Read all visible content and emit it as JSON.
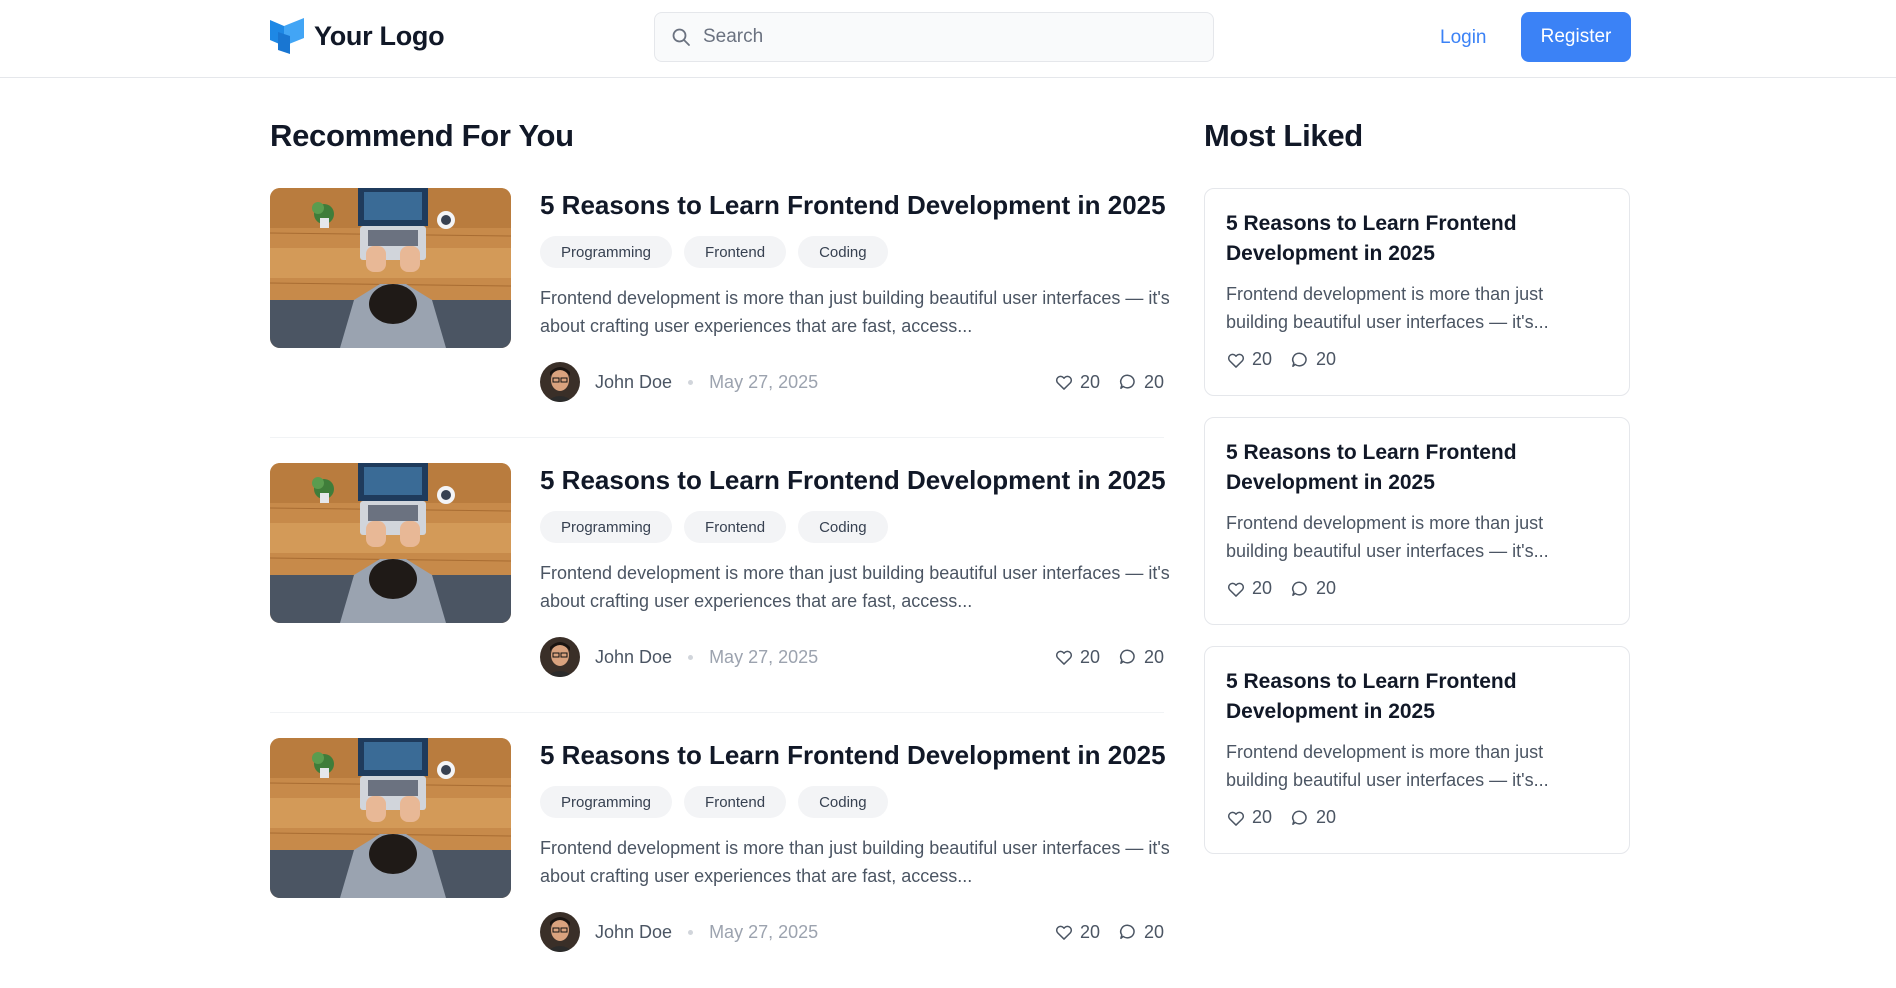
{
  "header": {
    "logo_text": "Your Logo",
    "search_placeholder": "Search",
    "login_label": "Login",
    "register_label": "Register",
    "brand_color": "#3b82f6"
  },
  "recommend": {
    "title": "Recommend For You",
    "articles": [
      {
        "title": "5 Reasons to Learn Frontend Development in 2025",
        "tags": [
          "Programming",
          "Frontend",
          "Coding"
        ],
        "excerpt": "Frontend development is more than just building beautiful user interfaces — it's about crafting user experiences that are fast, access...",
        "author": "John Doe",
        "date": "May 27, 2025",
        "likes": "20",
        "comments": "20"
      },
      {
        "title": "5 Reasons to Learn Frontend Development in 2025",
        "tags": [
          "Programming",
          "Frontend",
          "Coding"
        ],
        "excerpt": "Frontend development is more than just building beautiful user interfaces — it's about crafting user experiences that are fast, access...",
        "author": "John Doe",
        "date": "May 27, 2025",
        "likes": "20",
        "comments": "20"
      },
      {
        "title": "5 Reasons to Learn Frontend Development in 2025",
        "tags": [
          "Programming",
          "Frontend",
          "Coding"
        ],
        "excerpt": "Frontend development is more than just building beautiful user interfaces — it's about crafting user experiences that are fast, access...",
        "author": "John Doe",
        "date": "May 27, 2025",
        "likes": "20",
        "comments": "20"
      }
    ]
  },
  "most_liked": {
    "title": "Most Liked",
    "cards": [
      {
        "title": "5 Reasons to Learn Frontend Development in 2025",
        "excerpt": "Frontend development is more than just building beautiful user interfaces — it's...",
        "likes": "20",
        "comments": "20"
      },
      {
        "title": "5 Reasons to Learn Frontend Development in 2025",
        "excerpt": "Frontend development is more than just building beautiful user interfaces — it's...",
        "likes": "20",
        "comments": "20"
      },
      {
        "title": "5 Reasons to Learn Frontend Development in 2025",
        "excerpt": "Frontend development is more than just building beautiful user interfaces — it's...",
        "likes": "20",
        "comments": "20"
      }
    ]
  },
  "icons": {
    "search": "search-icon",
    "like": "heart-icon",
    "comment": "comment-icon"
  }
}
